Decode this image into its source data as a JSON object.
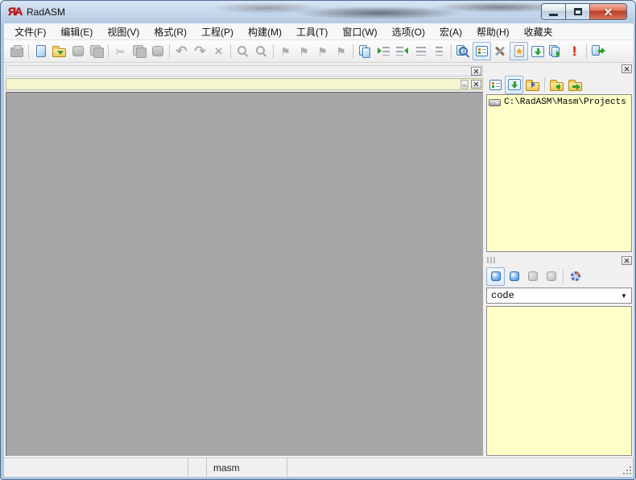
{
  "window": {
    "title": "RadASM"
  },
  "titlebar": {
    "controls": [
      "minimize",
      "maximize",
      "close"
    ]
  },
  "menu": {
    "items": [
      {
        "label": "文件(F)"
      },
      {
        "label": "编辑(E)"
      },
      {
        "label": "视图(V)"
      },
      {
        "label": "格式(R)"
      },
      {
        "label": "工程(P)"
      },
      {
        "label": "构建(M)"
      },
      {
        "label": "工具(T)"
      },
      {
        "label": "窗口(W)"
      },
      {
        "label": "选项(O)"
      },
      {
        "label": "宏(A)"
      },
      {
        "label": "帮助(H)"
      },
      {
        "label": "收藏夹"
      }
    ]
  },
  "toolbar": {
    "buttons": [
      {
        "name": "print",
        "enabled": false
      },
      {
        "name": "new-file",
        "enabled": true
      },
      {
        "name": "open-file",
        "enabled": true
      },
      {
        "name": "save",
        "enabled": false
      },
      {
        "name": "save-all",
        "enabled": false
      },
      {
        "name": "cut",
        "enabled": false
      },
      {
        "name": "copy",
        "enabled": false
      },
      {
        "name": "paste",
        "enabled": false
      },
      {
        "name": "undo",
        "enabled": false
      },
      {
        "name": "redo",
        "enabled": false
      },
      {
        "name": "delete",
        "enabled": false
      },
      {
        "name": "find",
        "enabled": false
      },
      {
        "name": "replace",
        "enabled": false
      },
      {
        "name": "toggle-bookmark",
        "enabled": false
      },
      {
        "name": "next-bookmark",
        "enabled": false
      },
      {
        "name": "prev-bookmark",
        "enabled": false
      },
      {
        "name": "clear-bookmarks",
        "enabled": false
      },
      {
        "name": "copy-lines",
        "enabled": true
      },
      {
        "name": "indent",
        "enabled": true
      },
      {
        "name": "outdent",
        "enabled": true
      },
      {
        "name": "justify",
        "enabled": false
      },
      {
        "name": "trim-lines",
        "enabled": false
      },
      {
        "name": "find-in-files",
        "enabled": true
      },
      {
        "name": "project-browser",
        "enabled": true,
        "pressed": true
      },
      {
        "name": "tools",
        "enabled": true
      },
      {
        "name": "favorites",
        "enabled": true,
        "pressed": true
      },
      {
        "name": "assemble",
        "enabled": true
      },
      {
        "name": "run",
        "enabled": true
      },
      {
        "name": "report-error",
        "enabled": true
      },
      {
        "name": "exit",
        "enabled": true
      }
    ]
  },
  "glyphs": {
    "logo": "ЯA",
    "cut": "✂",
    "undo": "↶",
    "redo": "↷",
    "delete": "×",
    "bookmark": "⚑",
    "star": "★",
    "exclamation": "!",
    "combo_arrow": "▼"
  },
  "project_panel": {
    "toolbar_icons": [
      "file-browser-list-icon",
      "get-files-icon",
      "browse-folder-icon",
      "folder-back-icon",
      "folder-forward-icon"
    ],
    "tree": {
      "items": [
        {
          "icon": "drive-icon",
          "label": "C:\\RadASM\\Masm\\Projects"
        }
      ]
    }
  },
  "properties_panel": {
    "toolbar_icons": [
      "section-code-icon",
      "section-data-icon",
      "section-disabled-1-icon",
      "section-disabled-2-icon",
      "properties-gear-icon"
    ],
    "combo_value": "code"
  },
  "statusbar": {
    "segments": [
      {
        "text": ""
      },
      {
        "text": ""
      },
      {
        "text": "masm"
      },
      {
        "text": ""
      }
    ]
  }
}
